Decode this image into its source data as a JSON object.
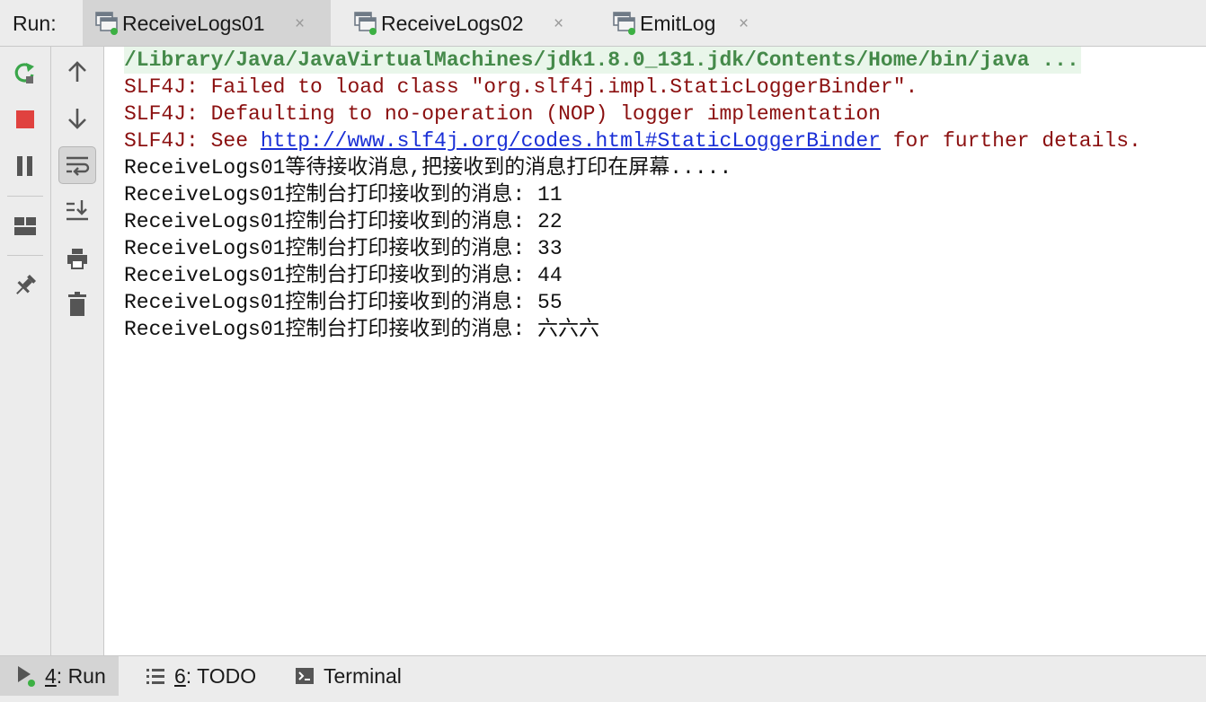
{
  "run_panel": {
    "label": "Run:",
    "tabs": [
      {
        "title": "ReceiveLogs01",
        "active": true
      },
      {
        "title": "ReceiveLogs02",
        "active": false
      },
      {
        "title": "EmitLog",
        "active": false
      }
    ],
    "close_glyph": "×"
  },
  "toolbar_left": [
    "rerun-icon",
    "stop-icon",
    "pause-icon",
    "layout-icon",
    "pin-icon"
  ],
  "toolbar_right": [
    "scroll-up-icon",
    "scroll-down-icon",
    "soft-wrap-icon",
    "scroll-to-end-icon",
    "print-icon",
    "clear-icon"
  ],
  "console": {
    "command_line": "/Library/Java/JavaVirtualMachines/jdk1.8.0_131.jdk/Contents/Home/bin/java ...",
    "errors": [
      "SLF4J: Failed to load class \"org.slf4j.impl.StaticLoggerBinder\".",
      "SLF4J: Defaulting to no-operation (NOP) logger implementation"
    ],
    "see_prefix": "SLF4J: See ",
    "see_link": "http://www.slf4j.org/codes.html#StaticLoggerBinder",
    "see_suffix": " for further details.",
    "output": [
      "ReceiveLogs01等待接收消息,把接收到的消息打印在屏幕.....",
      "ReceiveLogs01控制台打印接收到的消息: 11",
      "ReceiveLogs01控制台打印接收到的消息: 22",
      "ReceiveLogs01控制台打印接收到的消息: 33",
      "ReceiveLogs01控制台打印接收到的消息: 44",
      "ReceiveLogs01控制台打印接收到的消息: 55",
      "ReceiveLogs01控制台打印接收到的消息: 六六六"
    ]
  },
  "bottom_bar": {
    "tabs": [
      {
        "mnemonic": "4",
        "rest": ": Run",
        "active": true,
        "icon": "run-icon"
      },
      {
        "mnemonic": "6",
        "rest": ": TODO",
        "active": false,
        "icon": "todo-icon"
      },
      {
        "mnemonic": "",
        "rest": "Terminal",
        "active": false,
        "icon": "terminal-icon"
      }
    ]
  },
  "colors": {
    "command": "#458a4a",
    "error": "#8b1010",
    "link": "#1a2fd6",
    "output": "#111111"
  }
}
